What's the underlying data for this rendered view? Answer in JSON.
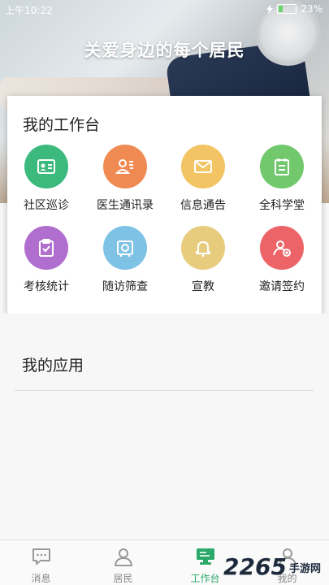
{
  "status_bar": {
    "time": "上午10:22",
    "battery": "23%",
    "battery_level": 0.23
  },
  "banner": {
    "title": "关爱身边的每个居民"
  },
  "workbench": {
    "title": "我的工作台",
    "items": [
      {
        "label": "社区巡诊",
        "icon": "id-card-icon",
        "color": "#3cba7d"
      },
      {
        "label": "医生通讯录",
        "icon": "contacts-icon",
        "color": "#ef8a52"
      },
      {
        "label": "信息通告",
        "icon": "mail-icon",
        "color": "#f2c463"
      },
      {
        "label": "全科学堂",
        "icon": "clipboard-icon",
        "color": "#72c96d"
      },
      {
        "label": "考核统计",
        "icon": "checklist-icon",
        "color": "#b06fcf"
      },
      {
        "label": "随访筛查",
        "icon": "follow-up-icon",
        "color": "#7ec3e5"
      },
      {
        "label": "宣教",
        "icon": "bell-icon",
        "color": "#e8cc7e"
      },
      {
        "label": "邀请签约",
        "icon": "add-user-icon",
        "color": "#ec6468"
      }
    ]
  },
  "apps": {
    "title": "我的应用"
  },
  "tabbar": {
    "tabs": [
      {
        "label": "消息",
        "icon": "message-icon",
        "active": false
      },
      {
        "label": "居民",
        "icon": "resident-icon",
        "active": false
      },
      {
        "label": "工作台",
        "icon": "workbench-icon",
        "active": true
      },
      {
        "label": "我的",
        "icon": "profile-icon",
        "active": false
      }
    ]
  },
  "watermark": {
    "number": "2265",
    "text": "手游网"
  }
}
